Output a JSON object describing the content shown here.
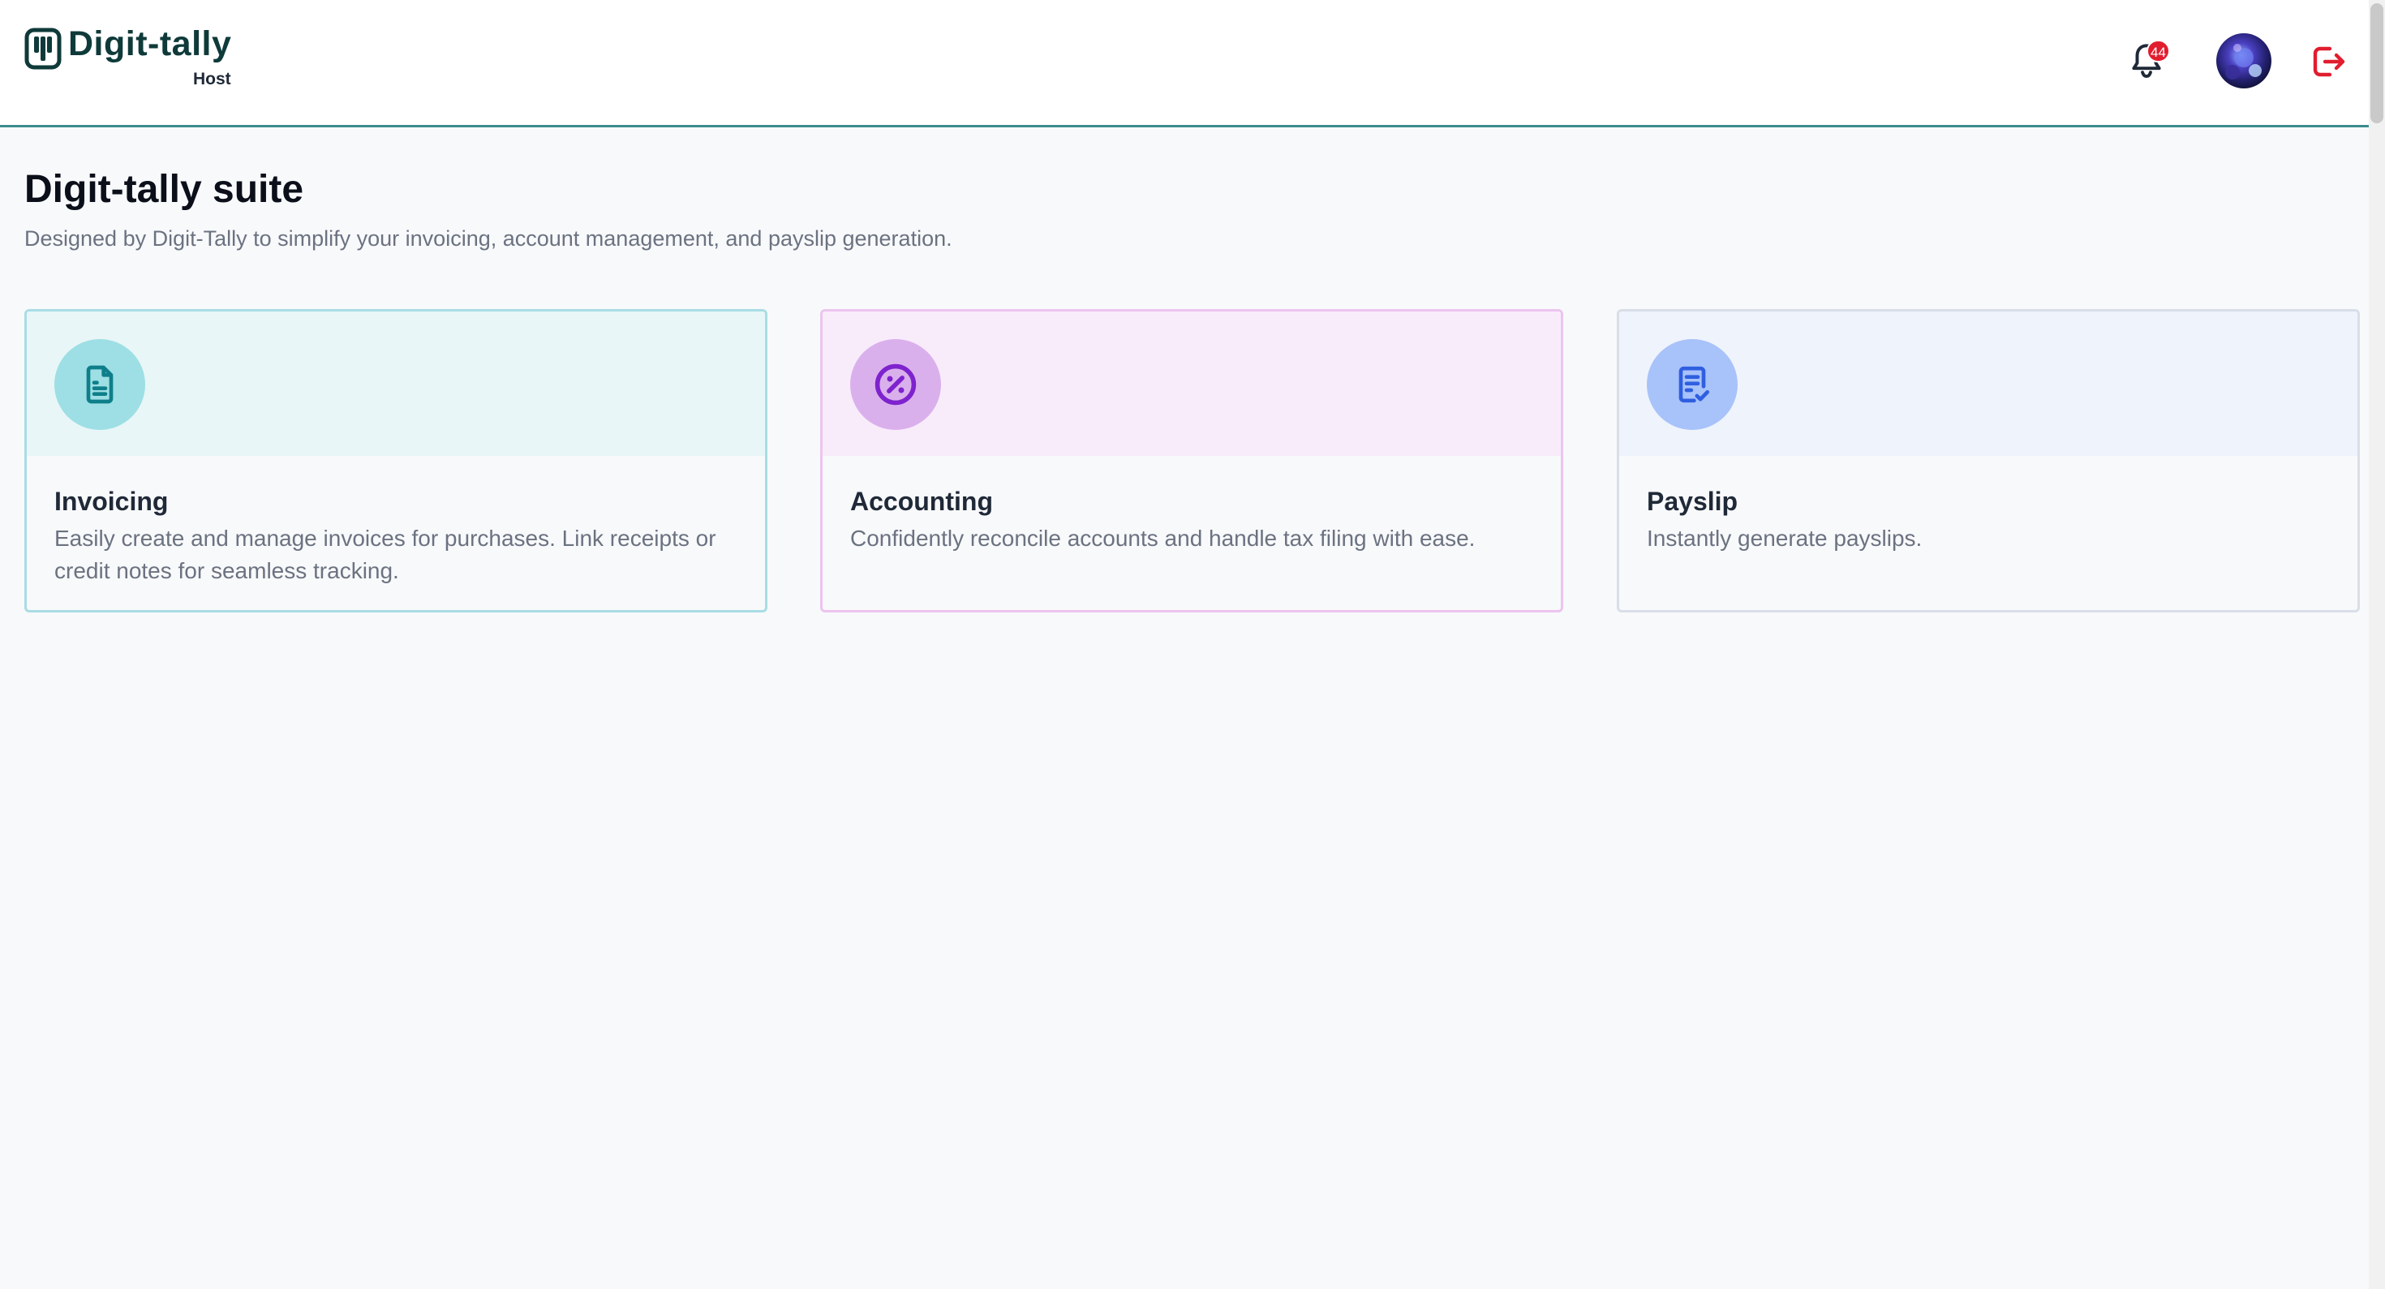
{
  "header": {
    "brand_name": "Digit-tally",
    "brand_sub": "Host",
    "notifications_count": "44",
    "logo_icon": "digit-tally-logo-icon",
    "bell_icon": "bell-icon",
    "logout_icon": "logout-icon"
  },
  "main": {
    "title": "Digit-tally suite",
    "subtitle": "Designed by Digit-Tally to simplify your invoicing, account management, and payslip generation.",
    "cards": [
      {
        "title": "Invoicing",
        "description": "Easily create and manage invoices for purchases. Link receipts or credit notes for seamless tracking.",
        "icon": "document-icon",
        "accent": "#0e7f8a"
      },
      {
        "title": "Accounting",
        "description": "Confidently reconcile accounts and handle tax filing with ease.",
        "icon": "percent-icon",
        "accent": "#7e22ce"
      },
      {
        "title": "Payslip",
        "description": "Instantly generate payslips.",
        "icon": "payslip-check-icon",
        "accent": "#2f5fe0"
      }
    ]
  },
  "colors": {
    "header_border": "#3b8c8c",
    "brand_text": "#0f3a3a",
    "badge": "#e11d2e",
    "logout": "#e11d2e",
    "page_background": "#f8f9fb"
  }
}
